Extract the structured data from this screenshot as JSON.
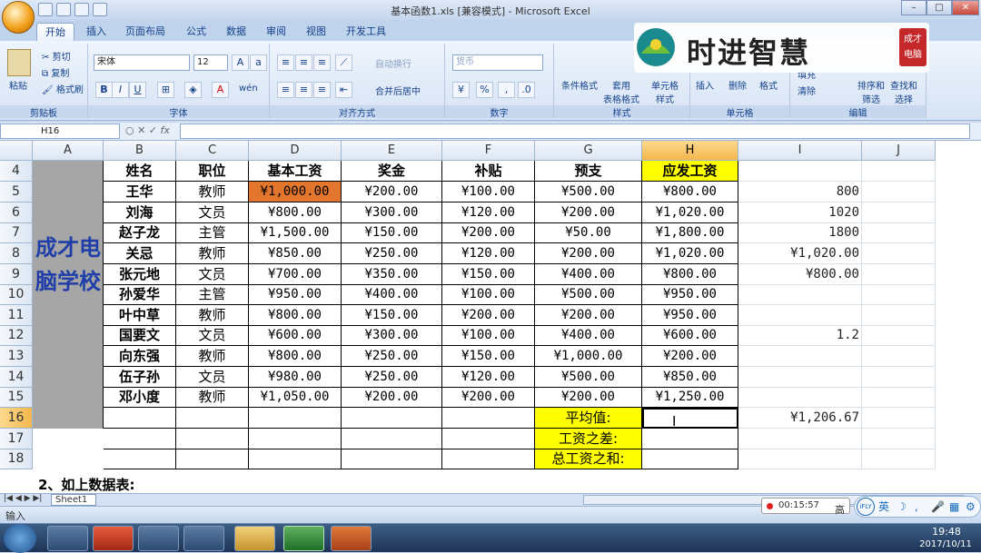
{
  "window": {
    "title": "基本函数1.xls  [兼容模式] - Microsoft Excel"
  },
  "tabs": [
    "开始",
    "插入",
    "页面布局",
    "公式",
    "数据",
    "审阅",
    "视图",
    "开发工具"
  ],
  "ribbon": {
    "clipboard": {
      "paste": "粘贴",
      "cut": "剪切",
      "copy": "复制",
      "format_painter": "格式刷",
      "label": "剪贴板"
    },
    "font": {
      "name": "宋体",
      "size": "12",
      "label": "字体",
      "pinyin": "wén"
    },
    "alignment": {
      "wrap": "自动换行",
      "merge": "合并后居中",
      "label": "对齐方式"
    },
    "number": {
      "format": "货币",
      "label": "数字"
    },
    "styles": {
      "conditional": "条件格式",
      "table": "套用\n表格格式",
      "cell": "单元格\n样式",
      "label": "样式"
    },
    "cells": {
      "insert": "插入",
      "delete": "删除",
      "format": "格式",
      "label": "单元格"
    },
    "editing": {
      "fill": "填充",
      "clear": "清除",
      "sort": "排序和\n筛选",
      "find": "查找和\n选择",
      "label": "编辑"
    }
  },
  "logo": {
    "text": "时进智慧",
    "seal": "成才电脑"
  },
  "namebox": "H16",
  "columns": [
    "A",
    "B",
    "C",
    "D",
    "E",
    "F",
    "G",
    "H",
    "I",
    "J"
  ],
  "rows": [
    "4",
    "5",
    "6",
    "7",
    "8",
    "9",
    "10",
    "11",
    "12",
    "13",
    "14",
    "15",
    "16",
    "17",
    "18"
  ],
  "school_name": "成才电脑学校",
  "table": {
    "headers": [
      "姓名",
      "职位",
      "基本工资",
      "奖金",
      "补贴",
      "预支",
      "应发工资"
    ],
    "records": [
      [
        "王华",
        "教师",
        "¥1,000.00",
        "¥200.00",
        "¥100.00",
        "¥500.00",
        "¥800.00"
      ],
      [
        "刘海",
        "文员",
        "¥800.00",
        "¥300.00",
        "¥120.00",
        "¥200.00",
        "¥1,020.00"
      ],
      [
        "赵子龙",
        "主管",
        "¥1,500.00",
        "¥150.00",
        "¥200.00",
        "¥50.00",
        "¥1,800.00"
      ],
      [
        "关忌",
        "教师",
        "¥850.00",
        "¥250.00",
        "¥120.00",
        "¥200.00",
        "¥1,020.00"
      ],
      [
        "张元地",
        "文员",
        "¥700.00",
        "¥350.00",
        "¥150.00",
        "¥400.00",
        "¥800.00"
      ],
      [
        "孙爱华",
        "主管",
        "¥950.00",
        "¥400.00",
        "¥100.00",
        "¥500.00",
        "¥950.00"
      ],
      [
        "叶中草",
        "教师",
        "¥800.00",
        "¥150.00",
        "¥200.00",
        "¥200.00",
        "¥950.00"
      ],
      [
        "国要文",
        "文员",
        "¥600.00",
        "¥300.00",
        "¥100.00",
        "¥400.00",
        "¥600.00"
      ],
      [
        "向东强",
        "教师",
        "¥800.00",
        "¥250.00",
        "¥150.00",
        "¥1,000.00",
        "¥200.00"
      ],
      [
        "伍子孙",
        "文员",
        "¥980.00",
        "¥250.00",
        "¥120.00",
        "¥500.00",
        "¥850.00"
      ],
      [
        "邓小度",
        "教师",
        "¥1,050.00",
        "¥200.00",
        "¥200.00",
        "¥200.00",
        "¥1,250.00"
      ]
    ],
    "summary_labels": [
      "平均值:",
      "工资之差:",
      "总工资之和:"
    ]
  },
  "column_i": {
    "5": "800",
    "6": "1020",
    "7": "1800",
    "8": "¥1,020.00",
    "9": "¥800.00",
    "12": "1.2",
    "16": "¥1,206.67"
  },
  "row19_text": "2、如上数据表:",
  "sheet_tab": "Sheet1",
  "status": {
    "mode": "输入",
    "timer": "00:15:57",
    "ifly_label": "iFLY",
    "lang": "英",
    "hi": "高"
  },
  "taskbar": {
    "time": "19:48",
    "date": "2017/10/11"
  },
  "colors": {
    "header_yellow": "#ffff00",
    "highlight_orange": "#e2762c",
    "merged_gray": "#a6a6a6",
    "school_blue": "#1f3ea8"
  }
}
